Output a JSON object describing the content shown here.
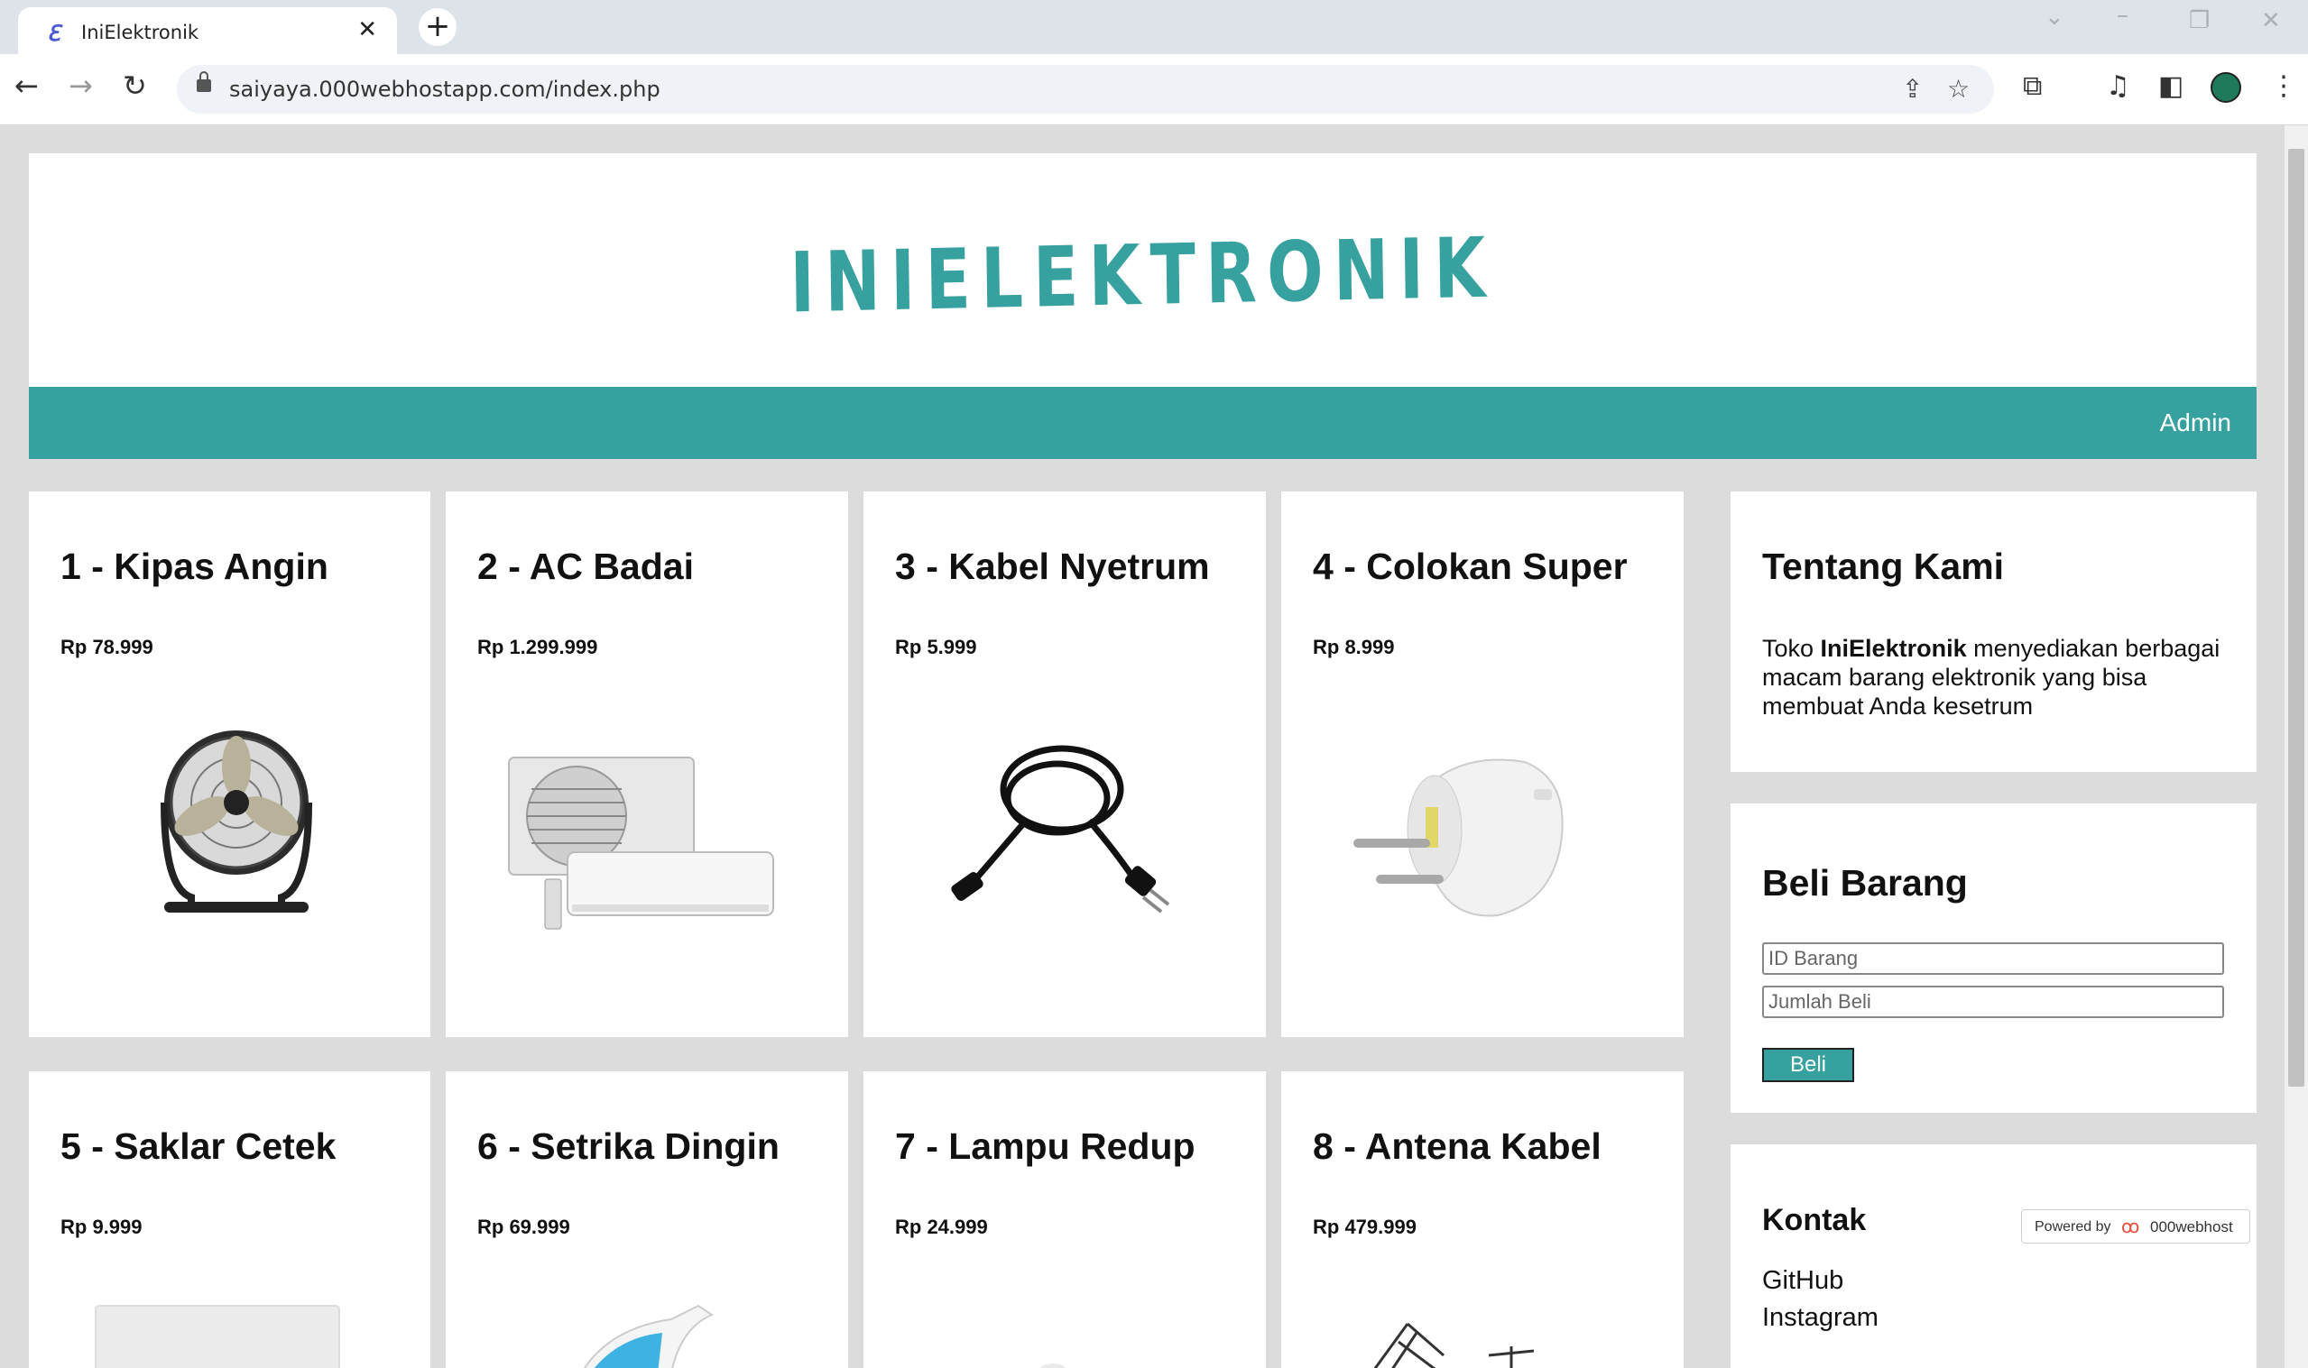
{
  "browser": {
    "tab_title": "IniElektronik",
    "tab_favicon": "ℇ",
    "close_glyph": "✕",
    "new_tab_glyph": "+",
    "url": "saiyaya.000webhostapp.com/index.php"
  },
  "site": {
    "logo": "INIELEKTRONIK",
    "nav_admin": "Admin"
  },
  "products": [
    {
      "title": "1 - Kipas Angin",
      "price": "Rp 78.999",
      "image": "fan-image"
    },
    {
      "title": "2 - AC Badai",
      "price": "Rp 1.299.999",
      "image": "air-conditioner-image"
    },
    {
      "title": "3 - Kabel Nyetrum",
      "price": "Rp 5.999",
      "image": "power-cable-image"
    },
    {
      "title": "4 - Colokan Super",
      "price": "Rp 8.999",
      "image": "plug-image"
    },
    {
      "title": "5 - Saklar Cetek",
      "price": "Rp 9.999",
      "image": "switch-image"
    },
    {
      "title": "6 - Setrika Dingin",
      "price": "Rp 69.999",
      "image": "iron-image"
    },
    {
      "title": "7 - Lampu Redup",
      "price": "Rp 24.999",
      "image": "lamp-image"
    },
    {
      "title": "8 - Antena Kabel",
      "price": "Rp 479.999",
      "image": "antenna-image"
    }
  ],
  "about": {
    "title": "Tentang Kami",
    "text_before": "Toko ",
    "text_bold": "IniElektronik",
    "text_after": " menyediakan berbagai macam barang elektronik yang bisa membuat Anda kesetrum"
  },
  "buy": {
    "title": "Beli Barang",
    "id_placeholder": "ID Barang",
    "qty_placeholder": "Jumlah Beli",
    "button": "Beli"
  },
  "contact": {
    "title": "Kontak",
    "links": [
      "GitHub",
      "Instagram"
    ]
  },
  "hosting_badge": {
    "powered_by": "Powered by",
    "brand": "000webhost"
  },
  "colors": {
    "accent": "#37a19f",
    "page_bg": "#dcdcdc"
  }
}
